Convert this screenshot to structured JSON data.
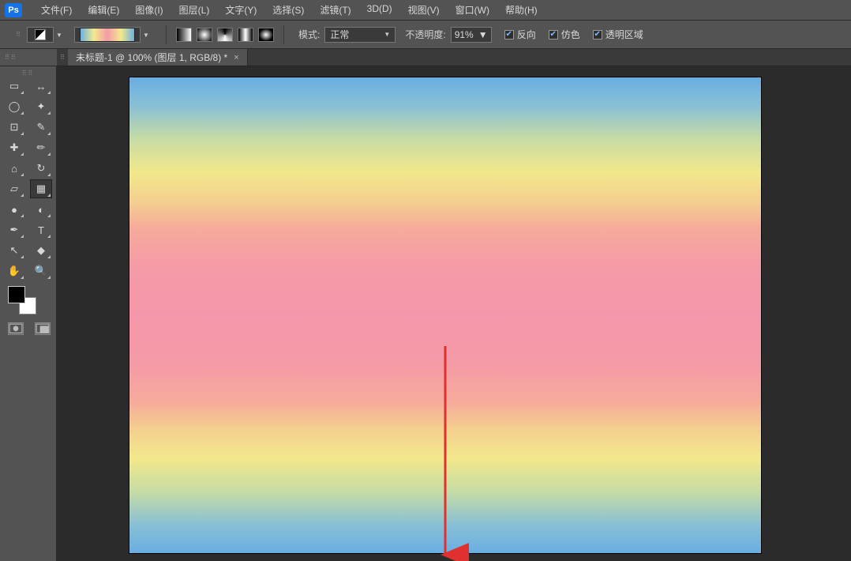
{
  "menu": {
    "items": [
      "文件(F)",
      "编辑(E)",
      "图像(I)",
      "图层(L)",
      "文字(Y)",
      "选择(S)",
      "滤镜(T)",
      "3D(D)",
      "视图(V)",
      "窗口(W)",
      "帮助(H)"
    ]
  },
  "logo": "Ps",
  "options": {
    "mode_label": "模式:",
    "mode_value": "正常",
    "opacity_label": "不透明度:",
    "opacity_value": "91%",
    "chk_reverse": "反向",
    "chk_dither": "仿色",
    "chk_trans": "透明区域"
  },
  "tab": {
    "title": "未标题-1 @ 100% (图层 1, RGB/8) *",
    "close": "×"
  },
  "tools": [
    [
      "marquee",
      "move"
    ],
    [
      "lasso",
      "wand"
    ],
    [
      "crop",
      "eyedropper"
    ],
    [
      "heal",
      "brush"
    ],
    [
      "stamp",
      "history-brush"
    ],
    [
      "eraser",
      "gradient"
    ],
    [
      "blur",
      "dodge"
    ],
    [
      "pen",
      "type"
    ],
    [
      "path-select",
      "shape"
    ],
    [
      "hand",
      "zoom"
    ]
  ],
  "selected_tool": "gradient",
  "tool_glyphs": {
    "marquee": "▭",
    "move": "↔",
    "lasso": "◯",
    "wand": "✦",
    "crop": "⊡",
    "eyedropper": "✎",
    "heal": "✚",
    "brush": "✏",
    "stamp": "⌂",
    "history-brush": "↻",
    "eraser": "▱",
    "gradient": "▦",
    "blur": "●",
    "dodge": "◐",
    "pen": "✒",
    "type": "T",
    "path-select": "↖",
    "shape": "◆",
    "hand": "✋",
    "zoom": "🔍"
  },
  "colors": {
    "fg": "#000000",
    "bg": "#ffffff"
  }
}
